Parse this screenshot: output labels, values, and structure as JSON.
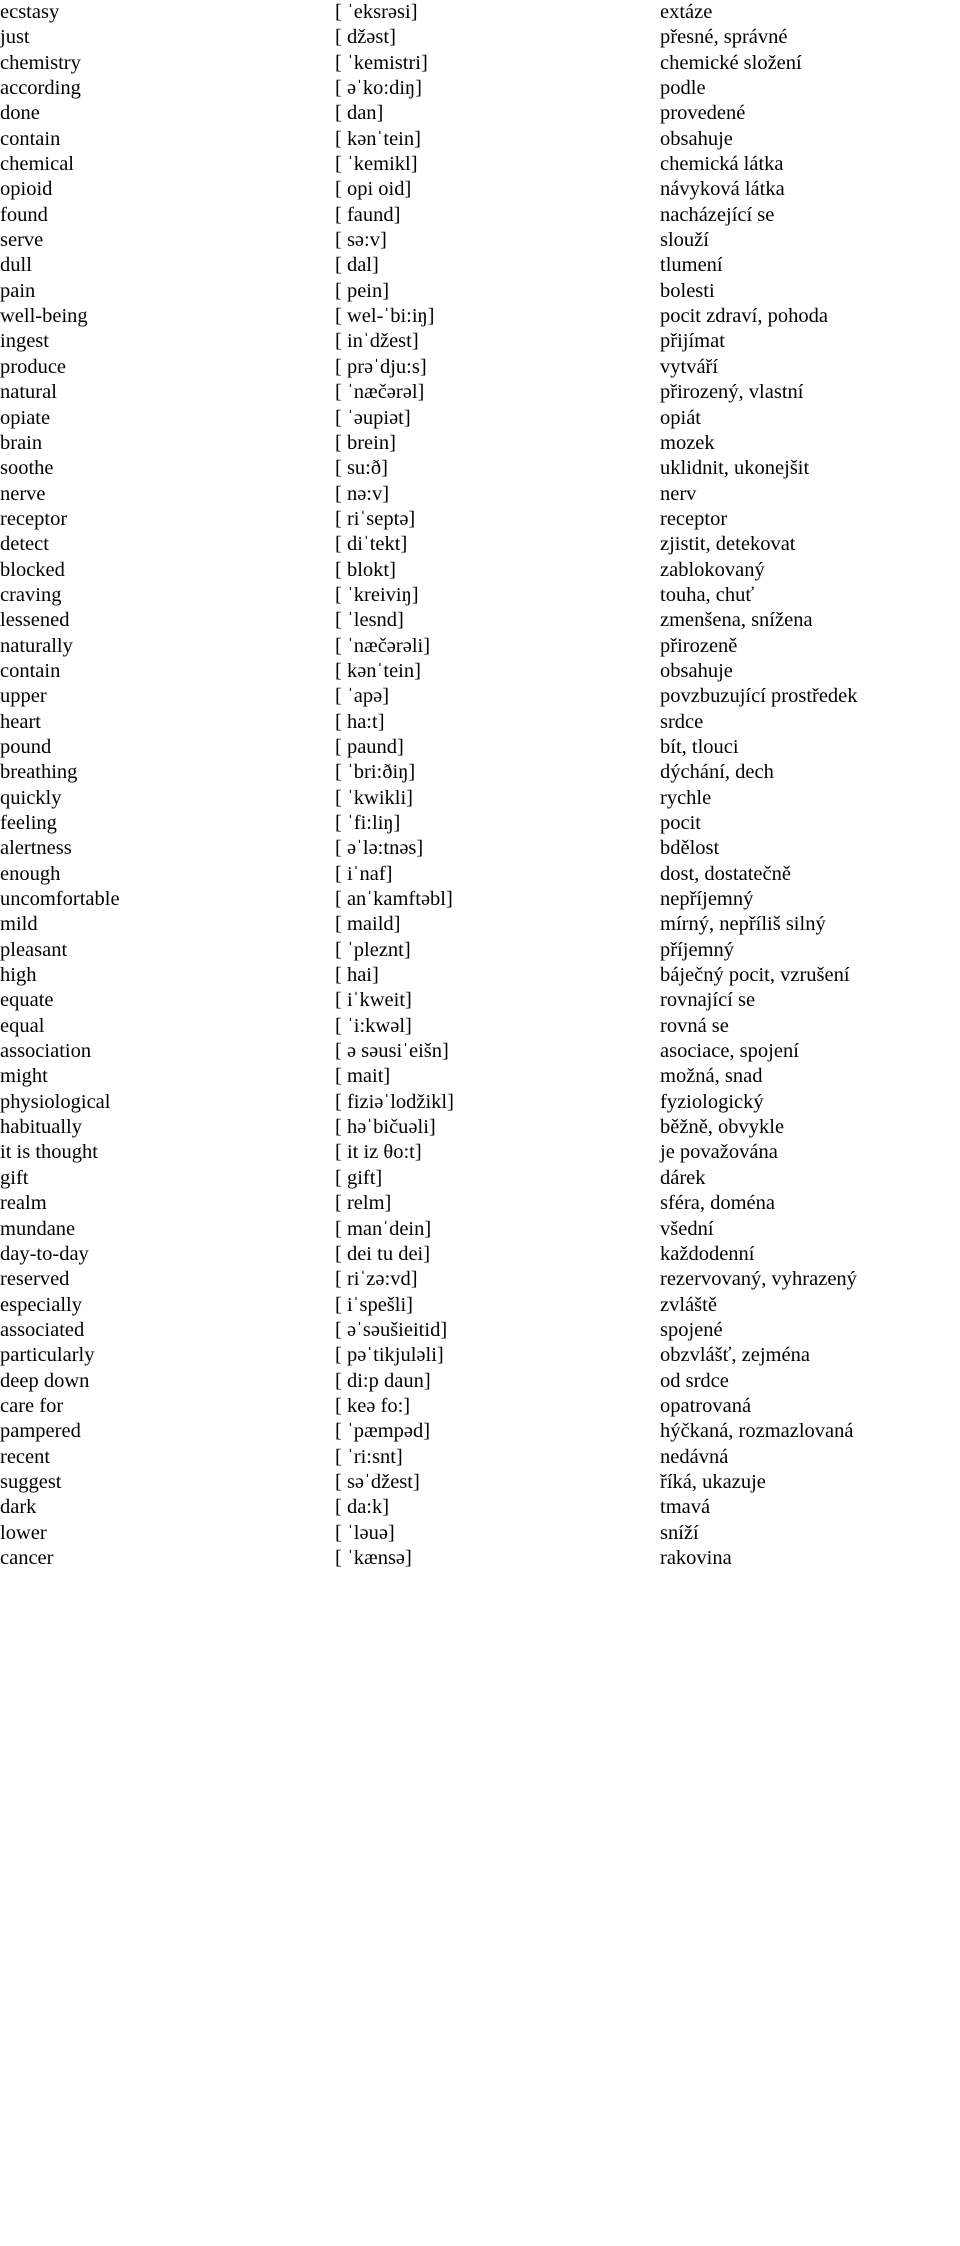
{
  "document": {
    "type": "vocabulary-list",
    "columns": [
      "english",
      "phonetic",
      "czech"
    ],
    "language_pair": "English – Czech"
  },
  "entries": [
    {
      "english": "ecstasy",
      "phonetic": "[ ˈeksrəsi]",
      "czech": "extáze"
    },
    {
      "english": "just",
      "phonetic": "[ džəst]",
      "czech": "přesné, správné"
    },
    {
      "english": "chemistry",
      "phonetic": "[ ˈkemistri]",
      "czech": "chemické složení"
    },
    {
      "english": "according",
      "phonetic": "[ əˈko:diŋ]",
      "czech": "podle"
    },
    {
      "english": "done",
      "phonetic": "[ dan]",
      "czech": "provedené"
    },
    {
      "english": "contain",
      "phonetic": "[ kənˈtein]",
      "czech": "obsahuje"
    },
    {
      "english": "chemical",
      "phonetic": "[ ˈkemikl]",
      "czech": "chemická látka"
    },
    {
      "english": "opioid",
      "phonetic": "[ opi oid]",
      "czech": "návyková látka"
    },
    {
      "english": "found",
      "phonetic": "[ faund]",
      "czech": "nacházející se"
    },
    {
      "english": "serve",
      "phonetic": "[ sə:v]",
      "czech": "slouží"
    },
    {
      "english": "dull",
      "phonetic": "[ dal]",
      "czech": "tlumení"
    },
    {
      "english": "pain",
      "phonetic": "[ pein]",
      "czech": "bolesti"
    },
    {
      "english": "well-being",
      "phonetic": "[ wel-ˈbi:iŋ]",
      "czech": "pocit zdraví, pohoda"
    },
    {
      "english": "ingest",
      "phonetic": "[ inˈdžest]",
      "czech": "přijímat"
    },
    {
      "english": "produce",
      "phonetic": "[ prəˈdju:s]",
      "czech": "vytváří"
    },
    {
      "english": "natural",
      "phonetic": "[ ˈnæčərəl]",
      "czech": "přirozený, vlastní"
    },
    {
      "english": "opiate",
      "phonetic": "[ ˈəupiət]",
      "czech": "opiát"
    },
    {
      "english": "brain",
      "phonetic": "[ brein]",
      "czech": "mozek"
    },
    {
      "english": "soothe",
      "phonetic": "[ su:ð]",
      "czech": "uklidnit, ukonejšit"
    },
    {
      "english": "nerve",
      "phonetic": "[ nə:v]",
      "czech": "nerv"
    },
    {
      "english": "receptor",
      "phonetic": "[ riˈseptə]",
      "czech": "receptor"
    },
    {
      "english": "detect",
      "phonetic": "[ diˈtekt]",
      "czech": "zjistit, detekovat"
    },
    {
      "english": "blocked",
      "phonetic": "[ blokt]",
      "czech": "zablokovaný"
    },
    {
      "english": "craving",
      "phonetic": "[ ˈkreiviŋ]",
      "czech": "touha, chuť"
    },
    {
      "english": "lessened",
      "phonetic": "[ ˈlesnd]",
      "czech": "zmenšena, snížena"
    },
    {
      "english": "naturally",
      "phonetic": "[ ˈnæčərəli]",
      "czech": "přirozeně"
    },
    {
      "english": "contain",
      "phonetic": "[ kənˈtein]",
      "czech": "obsahuje"
    },
    {
      "english": "upper",
      "phonetic": "[ ˈapə]",
      "czech": "povzbuzující prostředek"
    },
    {
      "english": "heart",
      "phonetic": "[ ha:t]",
      "czech": "srdce"
    },
    {
      "english": "pound",
      "phonetic": "[ paund]",
      "czech": "bít, tlouci"
    },
    {
      "english": "breathing",
      "phonetic": "[ ˈbri:ðiŋ]",
      "czech": "dýchání, dech"
    },
    {
      "english": "quickly",
      "phonetic": "[ ˈkwikli]",
      "czech": "rychle"
    },
    {
      "english": "feeling",
      "phonetic": "[ ˈfi:liŋ]",
      "czech": "pocit"
    },
    {
      "english": "alertness",
      "phonetic": "[ əˈlə:tnəs]",
      "czech": "bdělost"
    },
    {
      "english": "enough",
      "phonetic": "[ iˈnaf]",
      "czech": "dost, dostatečně"
    },
    {
      "english": "uncomfortable",
      "phonetic": "[ anˈkamftəbl]",
      "czech": "nepříjemný"
    },
    {
      "english": "mild",
      "phonetic": "[ maild]",
      "czech": "mírný, nepříliš silný"
    },
    {
      "english": "pleasant",
      "phonetic": "[ ˈpleznt]",
      "czech": "příjemný"
    },
    {
      "english": "high",
      "phonetic": "[ hai]",
      "czech": "báječný pocit, vzrušení"
    },
    {
      "english": "equate",
      "phonetic": "[ iˈkweit]",
      "czech": "rovnající se"
    },
    {
      "english": "equal",
      "phonetic": "[ ˈi:kwəl]",
      "czech": "rovná se"
    },
    {
      "english": "association",
      "phonetic": "[ ə səusiˈeišn]",
      "czech": "asociace, spojení"
    },
    {
      "english": "might",
      "phonetic": "[ mait]",
      "czech": "možná, snad"
    },
    {
      "english": "physiological",
      "phonetic": "[ fiziəˈlodžikl]",
      "czech": "fyziologický"
    },
    {
      "english": "habitually",
      "phonetic": "[ həˈbičuəli]",
      "czech": "běžně, obvykle"
    },
    {
      "english": "it is thought",
      "phonetic": "[ it iz θo:t]",
      "czech": "je považována"
    },
    {
      "english": "gift",
      "phonetic": "[ gift]",
      "czech": "dárek"
    },
    {
      "english": "realm",
      "phonetic": "[ relm]",
      "czech": "sféra, doména"
    },
    {
      "english": "mundane",
      "phonetic": "[ manˈdein]",
      "czech": "všední"
    },
    {
      "english": "day-to-day",
      "phonetic": "[ dei tu dei]",
      "czech": "každodenní"
    },
    {
      "english": "reserved",
      "phonetic": "[ riˈzə:vd]",
      "czech": "rezervovaný, vyhrazený"
    },
    {
      "english": "especially",
      "phonetic": "[ iˈspešli]",
      "czech": "zvláště"
    },
    {
      "english": "associated",
      "phonetic": "[ əˈsəušieitid]",
      "czech": "spojené"
    },
    {
      "english": "particularly",
      "phonetic": "[ pəˈtikjuləli]",
      "czech": "obzvlášť, zejména"
    },
    {
      "english": "deep down",
      "phonetic": "[ di:p daun]",
      "czech": "od srdce"
    },
    {
      "english": "care for",
      "phonetic": "[ keə fo:]",
      "czech": "opatrovaná"
    },
    {
      "english": "pampered",
      "phonetic": "[ ˈpæmpəd]",
      "czech": "hýčkaná, rozmazlovaná"
    },
    {
      "english": "recent",
      "phonetic": "[ ˈri:snt]",
      "czech": "nedávná"
    },
    {
      "english": "suggest",
      "phonetic": "[ səˈdžest]",
      "czech": "říká, ukazuje"
    },
    {
      "english": "dark",
      "phonetic": "[ da:k]",
      "czech": "tmavá"
    },
    {
      "english": "lower",
      "phonetic": "[ ˈləuə]",
      "czech": "sníží"
    },
    {
      "english": "cancer",
      "phonetic": "[ ˈkænsə]",
      "czech": "rakovina"
    }
  ]
}
